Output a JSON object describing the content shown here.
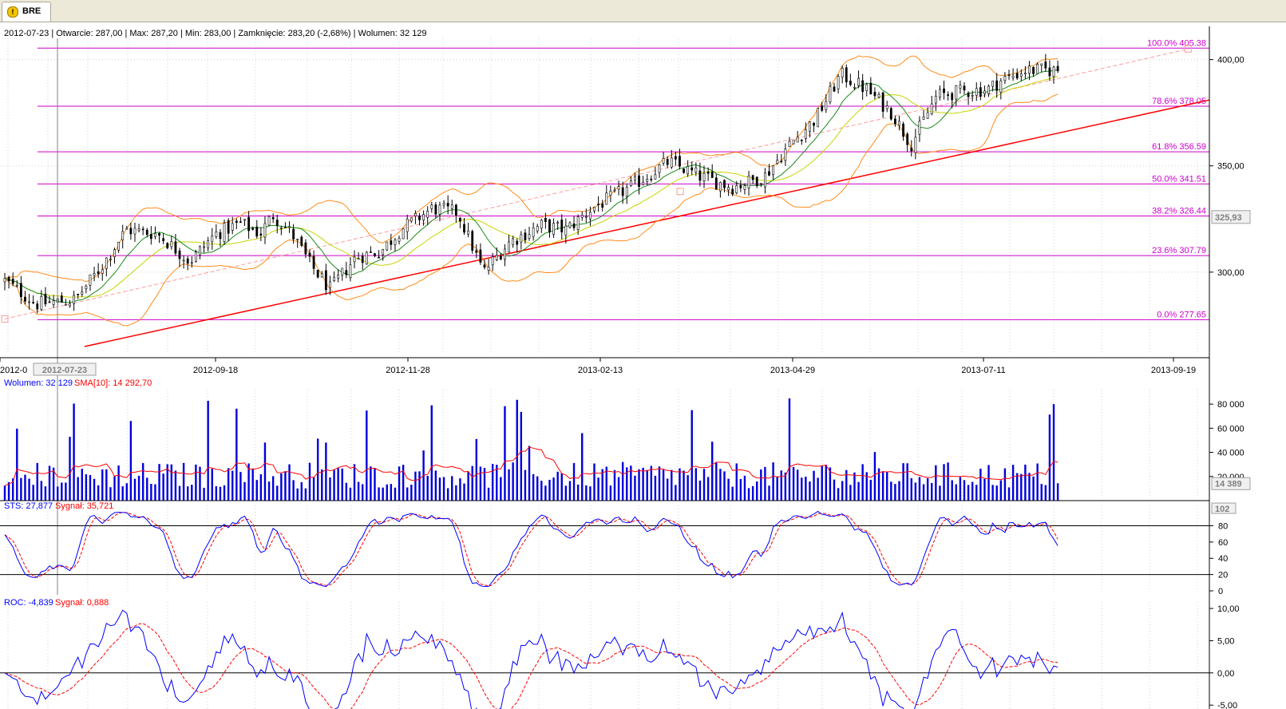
{
  "tab": {
    "label": "BRE",
    "icon": "warning-icon"
  },
  "info_line": "2012-07-23 | Otwarcie: 287,00 | Max: 287,20 | Min: 283,00 | Zamknięcie: 283,20 (-2,68%)  | Wolumen: 32 129",
  "colors": {
    "up": "#ffffff",
    "down": "#000000",
    "fib": "#cc00cc",
    "trend": "#ff0000",
    "trend_dashed": "#ff9a9a",
    "bollinger": "#ff8c1a",
    "ma_short": "#1c8a1c",
    "ma_long": "#c8d400",
    "volume": "#0000dd",
    "signal": "#ff0000",
    "osc": "#0000ff"
  },
  "chart_data": [
    {
      "type": "candlestick",
      "id": "price",
      "ylim": [
        262,
        410
      ],
      "ylabel": "",
      "y_ticks": [
        "300,00",
        "350,00",
        "400,00"
      ],
      "current_value": "325,93",
      "x_ticks": [
        "2012-0",
        "2012-09-18",
        "2012-11-28",
        "2013-02-13",
        "2013-04-29",
        "2013-07-11",
        "2013-09-19"
      ],
      "cursor_date": "2012-07-23",
      "fibonacci": [
        {
          "label": "100.0% 405.38",
          "value": 405.38
        },
        {
          "label": "78.6% 378.05",
          "value": 378.05
        },
        {
          "label": "61.8% 356.59",
          "value": 356.59
        },
        {
          "label": "50.0% 341.51",
          "value": 341.51
        },
        {
          "label": "38.2% 326.44",
          "value": 326.44
        },
        {
          "label": "23.6% 307.79",
          "value": 307.79
        },
        {
          "label": "0.0% 277.65",
          "value": 277.65
        }
      ],
      "anchors": [
        {
          "date": "2012-06-25",
          "price": 278
        },
        {
          "date": "2013-03-06",
          "price": 338
        },
        {
          "date": "2013-07-23",
          "price": 368
        },
        {
          "date": "2013-09-13",
          "price": 405
        }
      ],
      "trend_start": {
        "date": "2012-07-25",
        "price": 265
      },
      "trend_end": {
        "date": "2013-09-21",
        "price": 381
      },
      "x_range": [
        "2012-06-25",
        "2013-09-21"
      ],
      "bars": 260
    },
    {
      "type": "bar",
      "id": "volume",
      "series_label": "Wolumen: 32 129",
      "signal_label": "SMA[10]: 14 292,70",
      "ylim": [
        0,
        92000
      ],
      "y_ticks": [
        "20 000",
        "40 000",
        "60 000",
        "80 000"
      ],
      "current_value": "14 389"
    },
    {
      "type": "line",
      "id": "sts",
      "series_label": "STS: 27,877",
      "signal_label": "Sygnał: 35,721",
      "ylim": [
        0,
        105
      ],
      "y_ticks": [
        "0",
        "20",
        "40",
        "60",
        "80"
      ],
      "current_value": "102",
      "levels": [
        20,
        80
      ]
    },
    {
      "type": "line",
      "id": "roc",
      "series_label": "ROC: -4,839",
      "signal_label": "Sygnał: 0,888",
      "ylim": [
        -5.6,
        11
      ],
      "y_ticks": [
        "10,00",
        "5,00",
        "0,00",
        "-5,00"
      ],
      "levels": [
        0
      ]
    }
  ]
}
